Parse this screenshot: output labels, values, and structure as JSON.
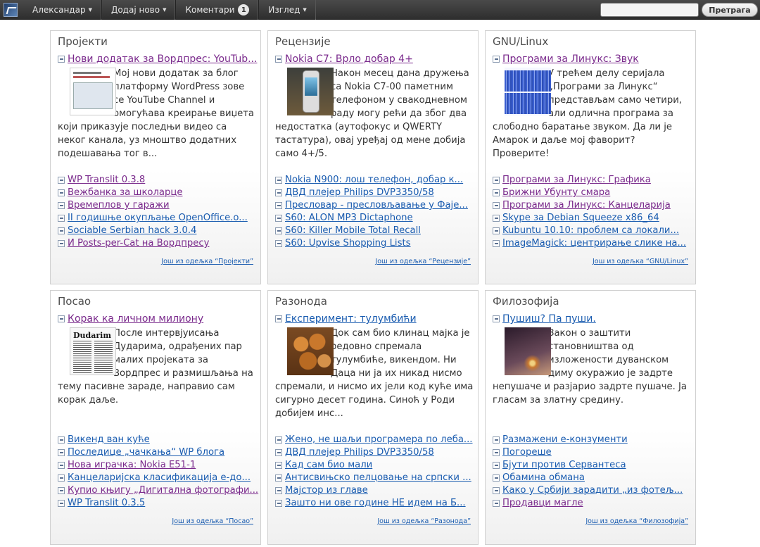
{
  "adminbar": {
    "menu": [
      {
        "label": "Александар",
        "caret": "▼"
      },
      {
        "label": "Додај ново",
        "caret": "▼"
      },
      {
        "label": "Коментари",
        "badge": "1"
      },
      {
        "label": "Изглед",
        "caret": "▼"
      }
    ],
    "search_value": "",
    "search_button": "Претрага"
  },
  "panels": [
    {
      "title": "Пројекти",
      "featured": "Нови додатак за Вордпрес: YouTub...",
      "excerpt": "Мој нови додатак за блог платформу WordPress зове се YouTube Channel и омогућава креирање виџета који приказује последњи видео са неког канала, уз мноштво додатних подешавања тог в...",
      "links": [
        "WP Translit 0.3.8",
        "Вежбанка за школарце",
        "Времеплов у гаражи",
        "II годишње окупљање OpenOffice.o...",
        "Sociable Serbian hack 3.0.4",
        "И Posts-per-Cat на Вордпресу"
      ],
      "more": "Још из одељка “Пројекти”"
    },
    {
      "title": "Рецензије",
      "featured": "Nokia C7: Врло добар 4+",
      "excerpt": "Након месец дана дружења са Nokia C7-00 паметним телефоном у свакодневном раду могу рећи да због два недостатка (аутофокус и QWERTY тастатура), овај уређај од мене добија само 4+/5.",
      "links": [
        "Nokia N900: лош телефон, добар к...",
        "ДВД плејер Philips DVP3350/58",
        "Пресловар - пресловљавање у Фаје...",
        "S60: ALON MP3 Dictaphone",
        "S60: Killer Mobile Total Recall",
        "S60: Upvise Shopping Lists"
      ],
      "more": "Још из одељка “Рецензије”"
    },
    {
      "title": "GNU/Linux",
      "featured": "Програми за Линукс: Звук",
      "excerpt": "У трећем делу серијала „Програми за Линукс“ представљам само четири, али одлична програма за слободно баратање звуком. Да ли је Амарок и даље мој фаворит? Проверите!",
      "links": [
        "Програми за Линукс: Графика",
        "Брижни Убунту смара",
        "Програми за Линукс: Канцеларија",
        "Skype за Debian Squeeze x86_64",
        "Kubuntu 10.10: проблем са локали...",
        "ImageMagick: центрирање слике на..."
      ],
      "more": "Још из одељка “GNU/Linux”"
    },
    {
      "title": "Посао",
      "featured": "Корак ка личном милиону",
      "excerpt": "После интервјуисања Дударима, одрађених пар малих пројеката за Вордпрес и размишљања на тему пасивне зараде, направио сам корак даље.",
      "links": [
        "Викенд ван куће",
        "Последице „чачкања“ WP блога",
        "Нова играчка: Nokia E51-1",
        "Канцеларијска класификација е-до...",
        "Купио књигу „Дигитална фотографи...",
        "WP Translit 0.3.5"
      ],
      "more": "Још из одељка “Посао”",
      "thumb_heading": "Dudarim"
    },
    {
      "title": "Разонода",
      "featured": "Експеримент: тулумбићи",
      "excerpt": "Док сам био клинац мајка је редовно спремала тулумбиће, викендом. Ни Даца ни ја их никад нисмо спремали, и нисмо их јели код куће има сигурно десет година. Синоћ у Роди добијем инс...",
      "links": [
        "Жено, не шаљи програмера по леба...",
        "ДВД плејер Philips DVP3350/58",
        "Кад сам био мали",
        "Антисвињско пелцовање на српски ...",
        "Мајстор из главе",
        "Зашто ни ове године НЕ идем на Б..."
      ],
      "more": "Још из одељка “Разонода”"
    },
    {
      "title": "Филозофија",
      "featured": "Пушиш? Па пуши.",
      "excerpt": "Закон о заштити становништва од изложености дуванском диму окуражио је задрте непушаче и разјарио задрте пушаче. Ја гласам за златну средину.",
      "links": [
        "Размажени е-конзументи",
        "Погореше",
        "Бјути против Сервантеса",
        "Обамина обмана",
        "Како у Србији зарадити „из фотељ...",
        "Продавци магле"
      ],
      "more": "Још из одељка “Филозофија”"
    }
  ],
  "colors": {
    "link": "#1a5cb0",
    "visited": "#7a2a8c",
    "adminbar": "#3a3a3a"
  }
}
